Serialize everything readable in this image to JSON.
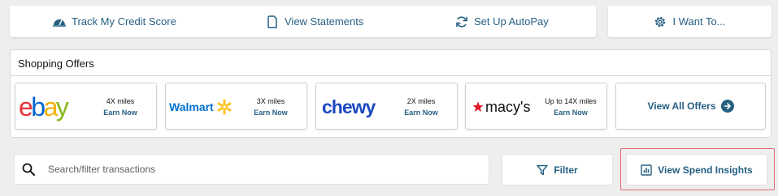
{
  "actions": {
    "credit_score": {
      "label": "Track My Credit Score",
      "icon": "credit-score-gauge-icon"
    },
    "statements": {
      "label": "View Statements",
      "icon": "document-icon"
    },
    "autopay": {
      "label": "Set Up AutoPay",
      "icon": "sync-icon"
    },
    "i_want_to": {
      "label": "I Want To...",
      "icon": "gear-icon"
    }
  },
  "offers": {
    "title": "Shopping Offers",
    "items": [
      {
        "merchant": "ebay",
        "miles": "4X miles",
        "cta": "Earn Now"
      },
      {
        "merchant": "Walmart",
        "miles": "3X miles",
        "cta": "Earn Now"
      },
      {
        "merchant": "chewy",
        "miles": "2X miles",
        "cta": "Earn Now"
      },
      {
        "merchant": "macy's",
        "miles": "Up to 14X miles",
        "cta": "Earn Now"
      }
    ],
    "view_all": "View All Offers"
  },
  "search": {
    "placeholder": "Search/filter transactions",
    "value": ""
  },
  "filter": {
    "label": "Filter"
  },
  "spend_insights": {
    "label": "View Spend Insights"
  },
  "colors": {
    "accent": "#255f82",
    "background": "#eeeeef",
    "highlight": "#e06a73",
    "walmart_blue": "#0071ce",
    "walmart_spark": "#ffc220",
    "chewy_blue": "#1c49c2",
    "macys_red": "#e21a2c"
  }
}
